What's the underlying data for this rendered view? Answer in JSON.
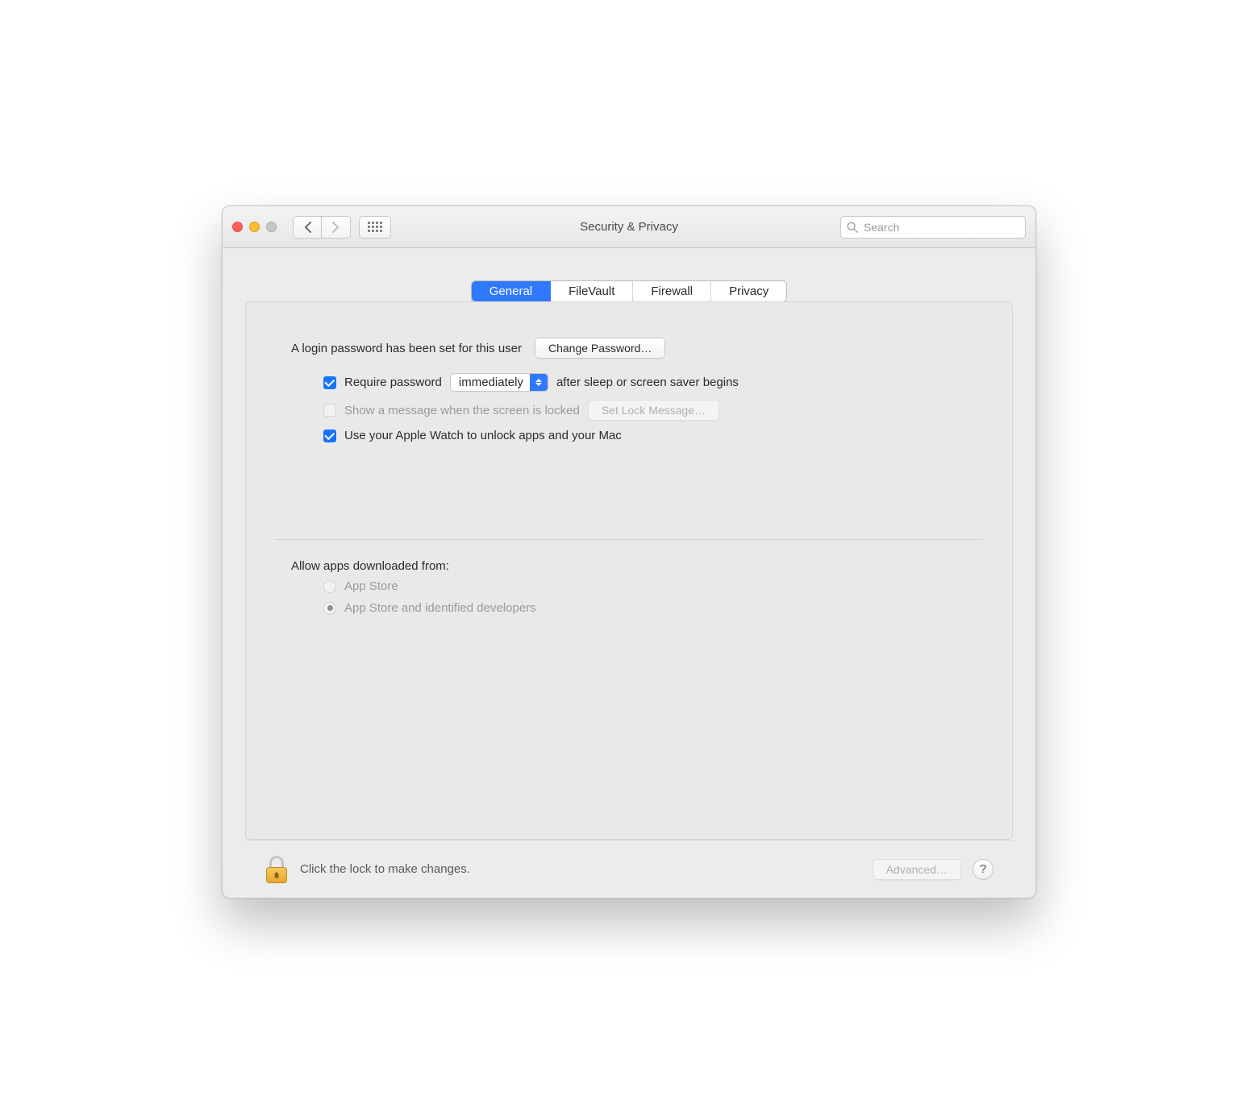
{
  "window": {
    "title": "Security & Privacy"
  },
  "search": {
    "placeholder": "Search"
  },
  "tabs": [
    "General",
    "FileVault",
    "Firewall",
    "Privacy"
  ],
  "general": {
    "login_password_text": "A login password has been set for this user",
    "change_password_label": "Change Password…",
    "require_password": {
      "checked": true,
      "label_before": "Require password",
      "select_value": "immediately",
      "label_after": "after sleep or screen saver begins"
    },
    "show_message": {
      "checked": false,
      "disabled": true,
      "label": "Show a message when the screen is locked",
      "set_message_label": "Set Lock Message…"
    },
    "apple_watch": {
      "checked": true,
      "label": "Use your Apple Watch to unlock apps and your Mac"
    },
    "allow_from": {
      "title": "Allow apps downloaded from:",
      "options": [
        {
          "label": "App Store",
          "selected": false
        },
        {
          "label": "App Store and identified developers",
          "selected": true
        }
      ],
      "disabled": true
    }
  },
  "footer": {
    "lock_text": "Click the lock to make changes.",
    "advanced_label": "Advanced…",
    "help_label": "?"
  }
}
